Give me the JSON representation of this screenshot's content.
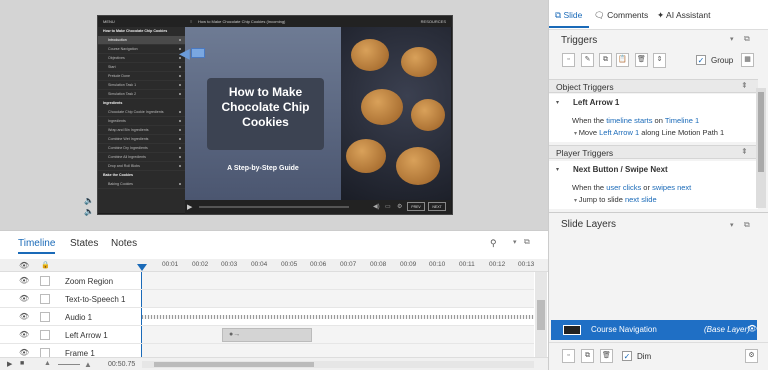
{
  "player": {
    "menu_title": "MENU",
    "breadcrumb": "How to Make Chocolate Chip Cookies (Incoming)",
    "resources": "RESOURCES",
    "sections": [
      {
        "title": "How to Make Chocolate Chip Cookies",
        "items": [
          "Introduction",
          "Course Navigation",
          "Objectives",
          "Start",
          "Prelude Done",
          "Simulation Task 1",
          "Simulation Task 2"
        ]
      },
      {
        "title": "Ingredients",
        "items": [
          "Chocolate Chip Cookie Ingredients",
          "Ingredients",
          "Wrap and Bin Ingredients",
          "Combine Wet Ingredients",
          "Combine Dry Ingredients",
          "Combine All Ingredients",
          "Drop and Roll Blobs"
        ]
      },
      {
        "title": "Bake the Cookies",
        "items": [
          "Baking Cookies"
        ]
      }
    ],
    "slide_title": "How to Make Chocolate Chip Cookies",
    "slide_subtitle": "A Step-by-Step Guide",
    "prev_label": "PREV",
    "next_label": "NEXT"
  },
  "timeline": {
    "tabs": [
      "Timeline",
      "States",
      "Notes"
    ],
    "ticks": [
      "00:01",
      "00:02",
      "00:03",
      "00:04",
      "00:05",
      "00:06",
      "00:07",
      "00:08",
      "00:09",
      "00:10",
      "00:11",
      "00:12",
      "00:13"
    ],
    "rows": [
      "Zoom Region",
      "Text-to-Speech 1",
      "Audio 1",
      "Left Arrow 1",
      "Frame 1"
    ],
    "duration": "00:50.75",
    "arrow_clip_label": "●→"
  },
  "right_panel": {
    "tabs": [
      "Slide",
      "Comments",
      "AI Assistant"
    ],
    "triggers_title": "Triggers",
    "group_label": "Group",
    "object_triggers_title": "Object Triggers",
    "object_trigger": {
      "name": "Left Arrow 1",
      "when_prefix": "When the ",
      "when_event": "timeline starts",
      "when_on": " on ",
      "when_target": "Timeline 1",
      "action_prefix": "Move ",
      "action_object": "Left Arrow 1",
      "action_suffix": " along Line Motion Path 1"
    },
    "player_triggers_title": "Player Triggers",
    "player_trigger": {
      "name": "Next Button / Swipe Next",
      "when_prefix": "When the ",
      "when_user": "user",
      "when_mid1": " ",
      "when_clicks": "clicks",
      "when_or": " or ",
      "when_swipes": "swipes",
      "when_sp": " ",
      "when_target": "next",
      "action_prefix": "Jump to slide ",
      "action_target": "next slide"
    },
    "slide_layers_title": "Slide Layers",
    "layer_name": "Course Navigation",
    "layer_tag": "(Base Layer)",
    "dim_label": "Dim"
  }
}
